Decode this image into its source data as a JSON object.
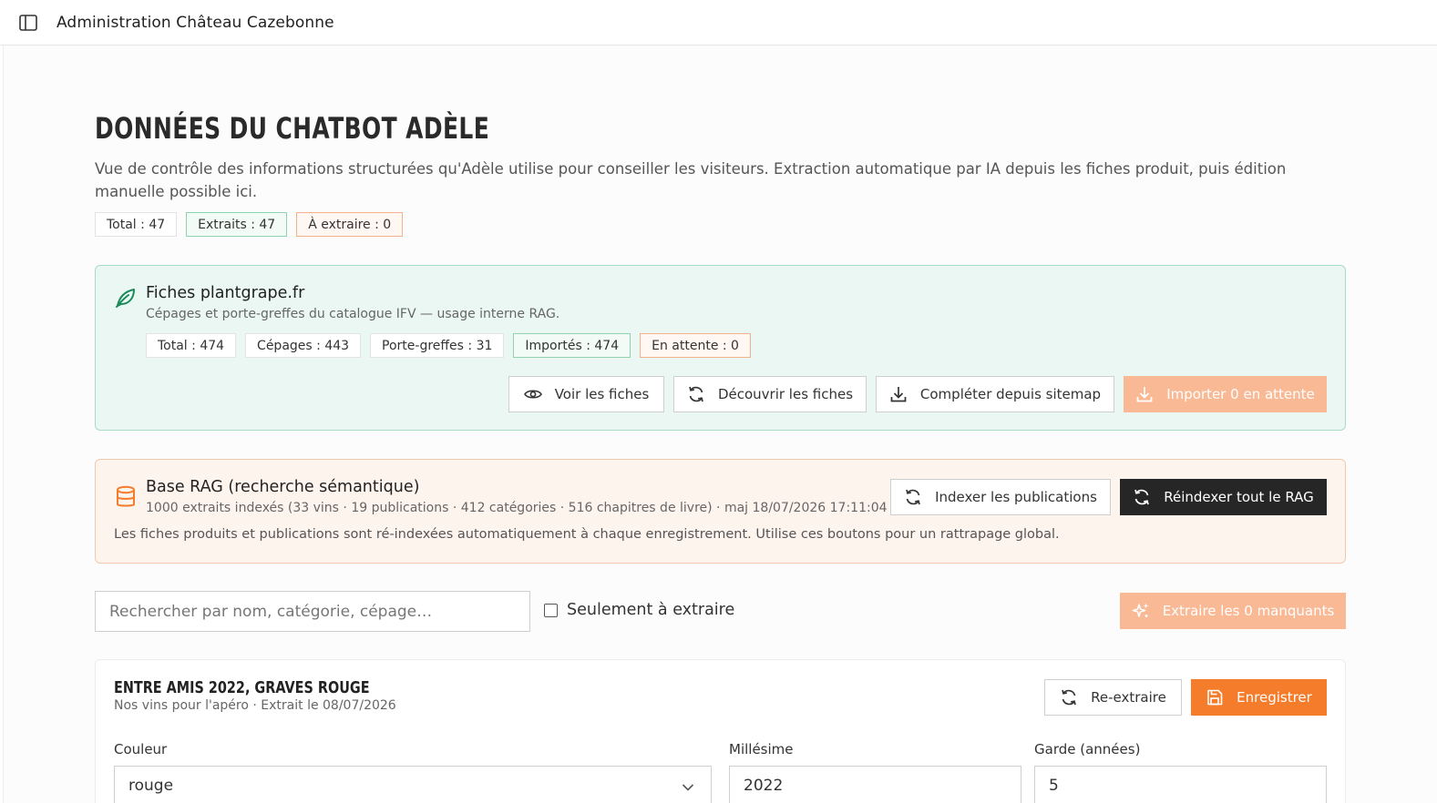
{
  "topbar": {
    "title": "Administration Château Cazebonne",
    "toggle_icon": "sidebar-toggle-icon"
  },
  "page": {
    "title": "DONNÉES DU CHATBOT ADÈLE",
    "description": "Vue de contrôle des informations structurées qu'Adèle utilise pour conseiller les visiteurs. Extraction automatique par IA depuis les fiches produit, puis édition manuelle possible ici.",
    "stats": {
      "total": "Total : 47",
      "extracted": "Extraits : 47",
      "to_extract": "À extraire : 0"
    }
  },
  "plantgrape": {
    "icon": "leaf-icon",
    "title": "Fiches plantgrape.fr",
    "subtitle": "Cépages et porte-greffes du catalogue IFV — usage interne RAG.",
    "stats": {
      "total": "Total : 474",
      "cepages": "Cépages : 443",
      "porte_greffes": "Porte-greffes : 31",
      "imported": "Importés : 474",
      "pending": "En attente : 0"
    },
    "buttons": {
      "view": "Voir les fiches",
      "discover": "Découvrir les fiches",
      "sitemap": "Compléter depuis sitemap",
      "import": "Importer 0 en attente"
    }
  },
  "rag": {
    "icon": "database-icon",
    "title": "Base RAG (recherche sémantique)",
    "subtitle": "1000 extraits indexés (33 vins · 19 publications · 412 catégories · 516 chapitres de livre) · maj 18/07/2026 17:11:04",
    "note": "Les fiches produits et publications sont ré-indexées automatiquement à chaque enregistrement. Utilise ces boutons pour un rattrapage global.",
    "buttons": {
      "index_publications": "Indexer les publications",
      "reindex_all": "Réindexer tout le RAG"
    }
  },
  "filters": {
    "search_placeholder": "Rechercher par nom, catégorie, cépage…",
    "only_to_extract": "Seulement à extraire",
    "extract_missing": "Extraire les 0 manquants"
  },
  "product": {
    "title": "ENTRE AMIS 2022, GRAVES ROUGE",
    "subtitle": "Nos vins pour l'apéro · Extrait le 08/07/2026",
    "buttons": {
      "re_extract": "Re-extraire",
      "save": "Enregistrer"
    },
    "fields": {
      "couleur": {
        "label": "Couleur",
        "value": "rouge"
      },
      "millesime": {
        "label": "Millésime",
        "value": "2022"
      },
      "garde": {
        "label": "Garde (années)",
        "value": "5"
      }
    }
  },
  "colors": {
    "accent_orange": "#f57c2b",
    "accent_green": "#1a8a5a",
    "dark": "#262626"
  }
}
